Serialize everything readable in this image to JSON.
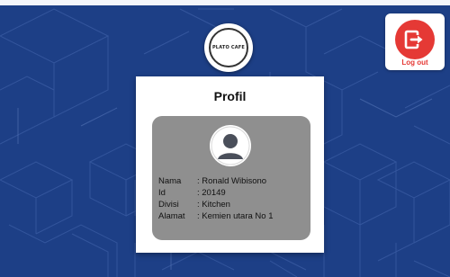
{
  "app": {
    "logo_text": "PLATO CAFE"
  },
  "logout": {
    "label": "Log out",
    "icon": "logout-icon",
    "color": "#e53935"
  },
  "profile": {
    "title": "Profil",
    "avatar_icon": "user-avatar-icon",
    "fields": [
      {
        "label": "Nama",
        "value": ": Ronald Wibisono"
      },
      {
        "label": "Id",
        "value": ": 20149"
      },
      {
        "label": "Divisi",
        "value": ": Kitchen"
      },
      {
        "label": "Alamat",
        "value": ": Kemien utara No 1"
      }
    ]
  },
  "colors": {
    "background": "#1d3f86",
    "panel": "#8f8f8f",
    "card": "#ffffff"
  }
}
